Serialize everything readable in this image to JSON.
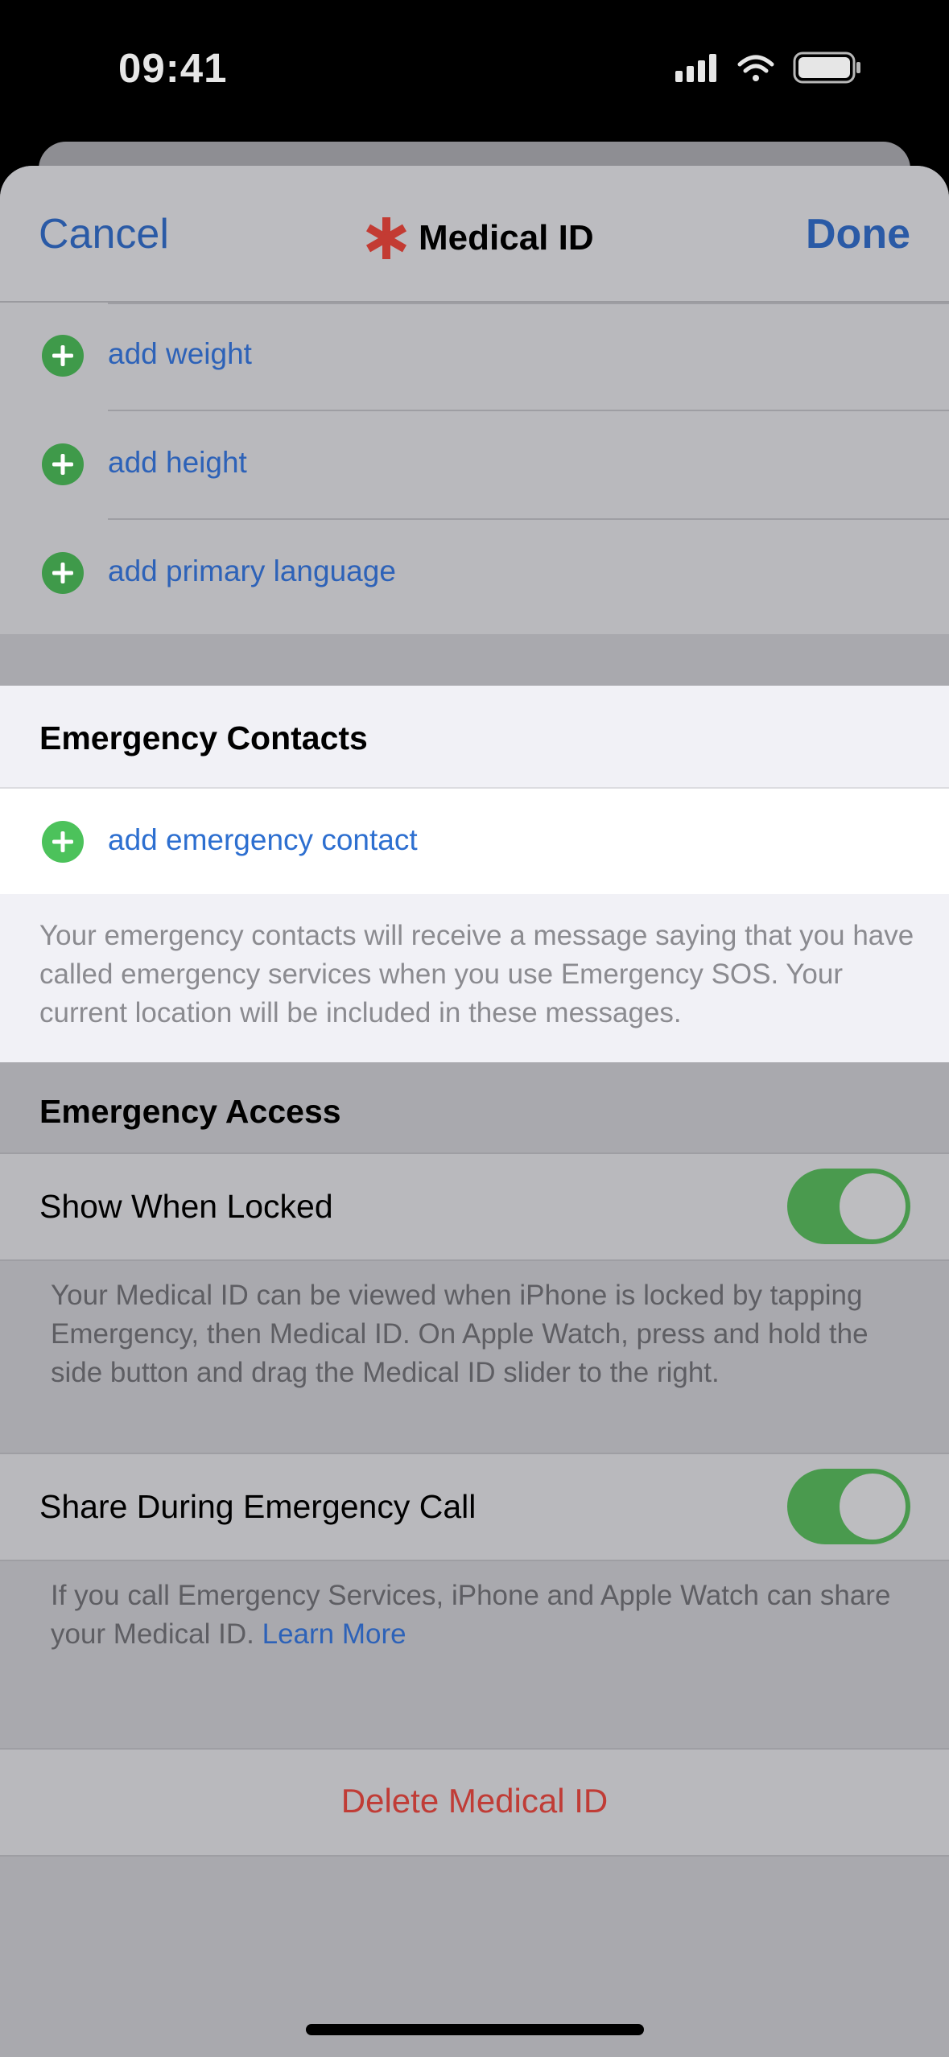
{
  "status_bar": {
    "time": "09:41"
  },
  "nav": {
    "cancel": "Cancel",
    "title": "Medical ID",
    "done": "Done"
  },
  "add_rows": [
    {
      "label": "add weight"
    },
    {
      "label": "add height"
    },
    {
      "label": "add primary language"
    }
  ],
  "emergency_contacts": {
    "header": "Emergency Contacts",
    "add_label": "add emergency contact",
    "footer": "Your emergency contacts will receive a message saying that you have called emergency services when you use Emergency SOS. Your current location will be included in these messages."
  },
  "emergency_access": {
    "header": "Emergency Access",
    "show_when_locked": {
      "label": "Show When Locked",
      "on": true,
      "footnote": "Your Medical ID can be viewed when iPhone is locked by tapping Emergency, then Medical ID. On Apple Watch, press and hold the side button and drag the Medical ID slider to the right."
    },
    "share_during_call": {
      "label": "Share During Emergency Call",
      "on": true,
      "footnote": "If you call Emergency Services, iPhone and Apple Watch can share your Medical ID.",
      "link": "Learn More"
    }
  },
  "delete_label": "Delete Medical ID",
  "colors": {
    "accent_blue": "#2d62b8",
    "medical_red": "#c33b33",
    "toggle_green": "#4a9a4e",
    "plus_green": "#3f9a4a",
    "plus_green_active": "#4cc25b"
  }
}
